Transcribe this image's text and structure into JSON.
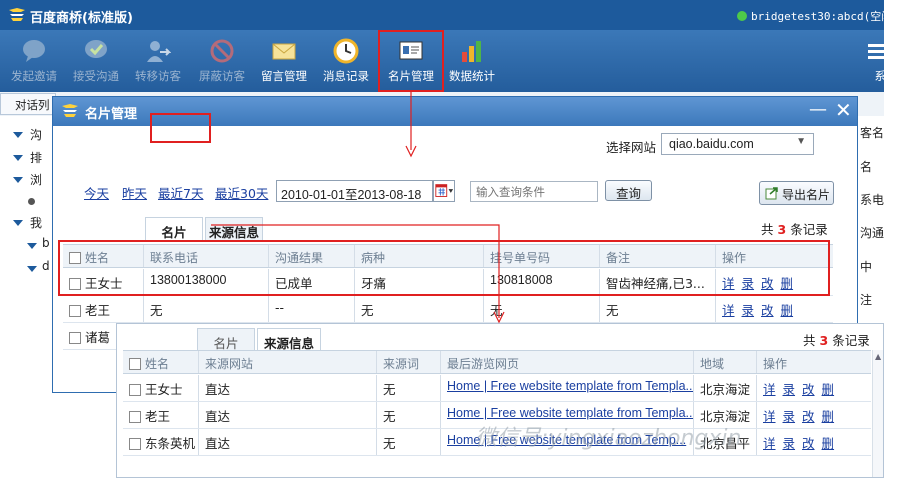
{
  "app": {
    "title": "百度商桥(标准版)",
    "account": "bridgetest30:abcd(空闲)",
    "status_color": "#4ec94a"
  },
  "toolbar": {
    "items": [
      {
        "label": "发起邀请",
        "icon": "chat-bubble-icon",
        "enabled": false
      },
      {
        "label": "接受沟通",
        "icon": "chat-check-icon",
        "enabled": false
      },
      {
        "label": "转移访客",
        "icon": "transfer-user-icon",
        "enabled": false
      },
      {
        "label": "屏蔽访客",
        "icon": "block-icon",
        "enabled": false
      },
      {
        "label": "留言管理",
        "icon": "envelope-icon",
        "enabled": true
      },
      {
        "label": "消息记录",
        "icon": "clock-icon",
        "enabled": true
      },
      {
        "label": "名片管理",
        "icon": "business-card-icon",
        "enabled": true
      },
      {
        "label": "数据统计",
        "icon": "bar-chart-icon",
        "enabled": true
      },
      {
        "label": "系统",
        "icon": "menu-icon",
        "enabled": true
      }
    ]
  },
  "sidebar": {
    "tab_label": "对话列",
    "tree": [
      "沟",
      "排",
      "浏",
      "●",
      "我",
      "b",
      "d"
    ]
  },
  "right_panel": [
    "客名片",
    "名",
    "系电话",
    "沟通结",
    "中",
    "注"
  ],
  "dialog": {
    "title": "名片管理",
    "site_label": "选择网站",
    "site_value": "qiao.baidu.com",
    "quick_links": [
      "今天",
      "昨天",
      "最近7天",
      "最近30天"
    ],
    "date_range": "2010-01-01至2013-08-18",
    "query_placeholder": "输入查询条件",
    "query_button": "查询",
    "export_button": "导出名片",
    "tabs": [
      "名片",
      "来源信息"
    ],
    "active_tab": 0,
    "record_prefix": "共",
    "record_count": "3",
    "record_suffix": "条记录",
    "columns": [
      "姓名",
      "联系电话",
      "沟通结果",
      "病种",
      "挂号单号码",
      "备注",
      "操作"
    ],
    "rows": [
      [
        "王女士",
        "13800138000",
        "已成单",
        "牙痛",
        "130818008",
        "智齿神经痛,已3..."
      ],
      [
        "老王",
        "无",
        "--",
        "无",
        "无",
        "无"
      ],
      [
        "诸葛",
        "",
        "",
        "",
        "",
        ""
      ]
    ],
    "actions": [
      "详",
      "录",
      "改",
      "删"
    ]
  },
  "popup": {
    "tabs": [
      "名片",
      "来源信息"
    ],
    "active_tab": 1,
    "record_prefix": "共",
    "record_count": "3",
    "record_suffix": "条记录",
    "columns": [
      "姓名",
      "来源网站",
      "来源词",
      "最后游览网页",
      "地域",
      "操作"
    ],
    "rows": [
      [
        "王女士",
        "直达",
        "无",
        "Home | Free website template from Templa...",
        "北京海淀"
      ],
      [
        "老王",
        "直达",
        "无",
        "Home | Free website template from Templa...",
        "北京海淀"
      ],
      [
        "东条英机",
        "直达",
        "无",
        "Home | Free website template from Temp...",
        "北京昌平"
      ]
    ],
    "actions": [
      "详",
      "录",
      "改",
      "删"
    ]
  },
  "watermark": "微信号:yingxiaozhongxin",
  "colors": {
    "title_bar": "#1d5a9c",
    "toolbar": "#2f6aab",
    "highlight": "#e02020",
    "link": "#1a3fa0"
  }
}
